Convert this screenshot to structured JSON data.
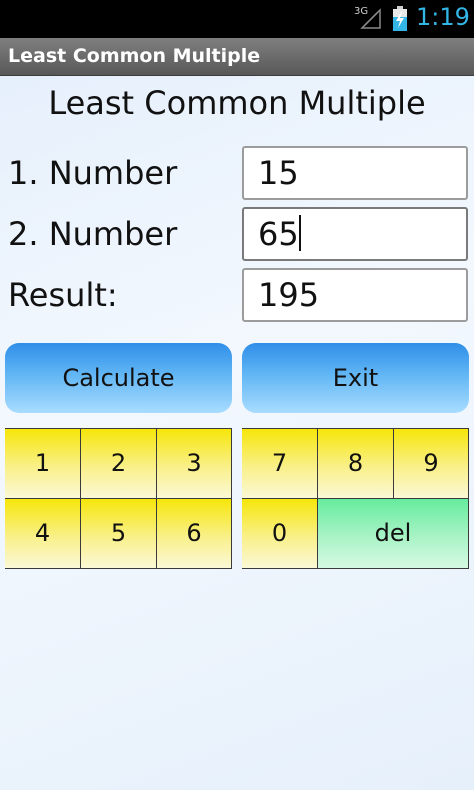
{
  "status_bar": {
    "network": "3G",
    "time": "1:19",
    "icons": [
      "signal-icon",
      "battery-charging-icon"
    ]
  },
  "app": {
    "title": "Least Common Multiple"
  },
  "main": {
    "heading": "Least Common Multiple",
    "number1": {
      "label": "1. Number",
      "value": "15"
    },
    "number2": {
      "label": "2. Number",
      "value": "65"
    },
    "result": {
      "label": "Result:",
      "value": "195"
    }
  },
  "buttons": {
    "calculate": "Calculate",
    "exit": "Exit"
  },
  "keypad": {
    "k1": "1",
    "k2": "2",
    "k3": "3",
    "k4": "4",
    "k5": "5",
    "k6": "6",
    "k7": "7",
    "k8": "8",
    "k9": "9",
    "k0": "0",
    "del": "del"
  },
  "colors": {
    "key_yellow": "#f6e60a",
    "key_del_green": "#66ec9d",
    "button_blue": "#2f8ee8",
    "status_accent": "#33b5e5"
  }
}
